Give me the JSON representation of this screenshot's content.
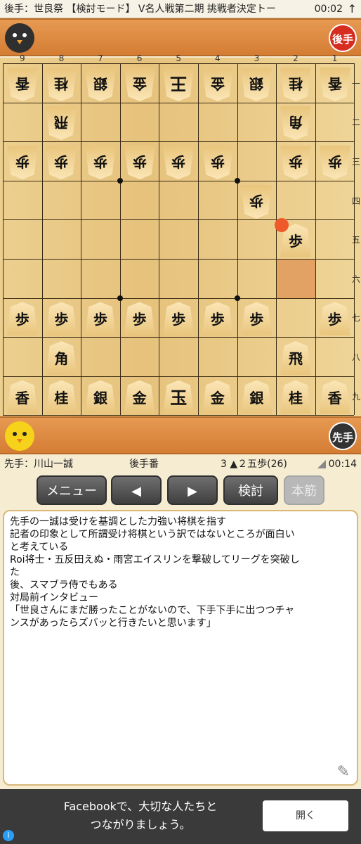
{
  "status": {
    "title": "後手：世良祭 【検討モード】 V名人戦第二期 挑戦者決定トー",
    "time": "00:02",
    "arrow": "↑"
  },
  "players": {
    "gote_badge": "後手",
    "sente_badge": "先手",
    "gote_avatar": "black-bird-avatar",
    "sente_avatar": "yellow-chick-avatar"
  },
  "board": {
    "file_labels": [
      "9",
      "8",
      "7",
      "6",
      "5",
      "4",
      "3",
      "2",
      "1"
    ],
    "rank_labels": [
      "一",
      "二",
      "三",
      "四",
      "五",
      "六",
      "七",
      "八",
      "九"
    ],
    "last_move_square": {
      "file": 2,
      "rank": 6
    },
    "marker_square": {
      "file": 2,
      "rank": 5
    },
    "pieces": [
      {
        "side": "gote",
        "file": 9,
        "rank": 1,
        "ch": "香"
      },
      {
        "side": "gote",
        "file": 8,
        "rank": 1,
        "ch": "桂"
      },
      {
        "side": "gote",
        "file": 7,
        "rank": 1,
        "ch": "銀"
      },
      {
        "side": "gote",
        "file": 6,
        "rank": 1,
        "ch": "金"
      },
      {
        "side": "gote",
        "file": 5,
        "rank": 1,
        "ch": "王",
        "king": true
      },
      {
        "side": "gote",
        "file": 4,
        "rank": 1,
        "ch": "金"
      },
      {
        "side": "gote",
        "file": 3,
        "rank": 1,
        "ch": "銀"
      },
      {
        "side": "gote",
        "file": 2,
        "rank": 1,
        "ch": "桂"
      },
      {
        "side": "gote",
        "file": 1,
        "rank": 1,
        "ch": "香"
      },
      {
        "side": "gote",
        "file": 8,
        "rank": 2,
        "ch": "飛"
      },
      {
        "side": "gote",
        "file": 2,
        "rank": 2,
        "ch": "角"
      },
      {
        "side": "gote",
        "file": 9,
        "rank": 3,
        "ch": "歩"
      },
      {
        "side": "gote",
        "file": 8,
        "rank": 3,
        "ch": "歩"
      },
      {
        "side": "gote",
        "file": 7,
        "rank": 3,
        "ch": "歩"
      },
      {
        "side": "gote",
        "file": 6,
        "rank": 3,
        "ch": "歩"
      },
      {
        "side": "gote",
        "file": 5,
        "rank": 3,
        "ch": "歩"
      },
      {
        "side": "gote",
        "file": 4,
        "rank": 3,
        "ch": "歩"
      },
      {
        "side": "gote",
        "file": 2,
        "rank": 3,
        "ch": "歩"
      },
      {
        "side": "gote",
        "file": 1,
        "rank": 3,
        "ch": "歩"
      },
      {
        "side": "gote",
        "file": 3,
        "rank": 4,
        "ch": "歩"
      },
      {
        "side": "sente",
        "file": 2,
        "rank": 5,
        "ch": "歩"
      },
      {
        "side": "sente",
        "file": 9,
        "rank": 7,
        "ch": "歩"
      },
      {
        "side": "sente",
        "file": 8,
        "rank": 7,
        "ch": "歩"
      },
      {
        "side": "sente",
        "file": 7,
        "rank": 7,
        "ch": "歩"
      },
      {
        "side": "sente",
        "file": 6,
        "rank": 7,
        "ch": "歩"
      },
      {
        "side": "sente",
        "file": 5,
        "rank": 7,
        "ch": "歩"
      },
      {
        "side": "sente",
        "file": 4,
        "rank": 7,
        "ch": "歩"
      },
      {
        "side": "sente",
        "file": 3,
        "rank": 7,
        "ch": "歩"
      },
      {
        "side": "sente",
        "file": 1,
        "rank": 7,
        "ch": "歩"
      },
      {
        "side": "sente",
        "file": 8,
        "rank": 8,
        "ch": "角"
      },
      {
        "side": "sente",
        "file": 2,
        "rank": 8,
        "ch": "飛"
      },
      {
        "side": "sente",
        "file": 9,
        "rank": 9,
        "ch": "香"
      },
      {
        "side": "sente",
        "file": 8,
        "rank": 9,
        "ch": "桂"
      },
      {
        "side": "sente",
        "file": 7,
        "rank": 9,
        "ch": "銀"
      },
      {
        "side": "sente",
        "file": 6,
        "rank": 9,
        "ch": "金"
      },
      {
        "side": "sente",
        "file": 5,
        "rank": 9,
        "ch": "玉",
        "king": true
      },
      {
        "side": "sente",
        "file": 4,
        "rank": 9,
        "ch": "金"
      },
      {
        "side": "sente",
        "file": 3,
        "rank": 9,
        "ch": "銀"
      },
      {
        "side": "sente",
        "file": 2,
        "rank": 9,
        "ch": "桂"
      },
      {
        "side": "sente",
        "file": 1,
        "rank": 9,
        "ch": "香"
      }
    ]
  },
  "info": {
    "sente_name": "先手：川山一誠",
    "turn": "後手番",
    "move": "3 ▲２五歩(26)",
    "time": "00:14"
  },
  "buttons": {
    "menu": "メニュー",
    "prev": "◀",
    "next": "▶",
    "analyze": "検討",
    "mainline": "本筋"
  },
  "comment": {
    "lines": [
      "先手の一誠は受けを基調とした力強い将棋を指す",
      "記者の印象として所謂受け将棋という訳ではないところが面白い",
      "と考えている",
      "Roi将士・五反田えぬ・雨宮エイスリンを撃破してリーグを突破し",
      "た",
      "後、スマブラ侍でもある",
      "対局前インタビュー",
      "「世良さんにまだ勝ったことがないので、下手下手に出つつチャ",
      "ンスがあったらズバッと行きたいと思います」"
    ]
  },
  "ad": {
    "line1": "Facebookで、大切な人たちと",
    "line2": "つながりましょう。",
    "open": "開く",
    "info": "i"
  }
}
